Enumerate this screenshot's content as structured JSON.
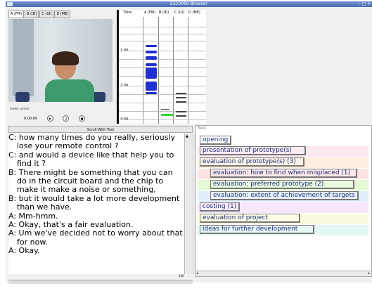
{
  "window": {
    "title": "ES20060 Browser"
  },
  "tabs": [
    "A (FM)",
    "B (ID)",
    "C (UI)",
    "D (ME)"
  ],
  "media": {
    "label": "media control",
    "time": "0:00:00"
  },
  "timeline": {
    "headers": [
      "Time",
      "A (FM)",
      "B (ID)",
      "C (UI)",
      "D (ME)"
    ],
    "ticks": [
      "1:00",
      "2:00",
      "3:00"
    ]
  },
  "scroll_button": "Scroll With Text",
  "transcript": [
    "C: how many times do you really, seriously lose your  remote control ?",
    "C: and would a device like that help you to find it ?",
    "B: There might be something that you can do in the circuit board and the chip to make it make a noise or something,",
    "B: but it would take a lot more development than we have.",
    "A: Mm-hmm.",
    "A: Okay, that's a fair evaluation.",
    "A: Um we've decided not to worry about that for now.",
    "A: Okay."
  ],
  "transcript_zoom": "100",
  "topics_label": "Topics",
  "topics": [
    {
      "label": "opening",
      "bg": "#ffffff"
    },
    {
      "label": "presentation of prototype(s)",
      "bg": "#fde7ef"
    },
    {
      "label": "evaluation of prototype(s) (3)",
      "bg": "#fdeee0"
    },
    {
      "label": "evaluation: how to find when misplaced (1)",
      "bg": "#fde3e3"
    },
    {
      "label": "evaluation: preferred prototype (2)",
      "bg": "#e6f8d6"
    },
    {
      "label": "evaluation: extent of achievement of targets",
      "bg": "#e3eefc"
    },
    {
      "label": "costing (1)",
      "bg": "#f6e8f9"
    },
    {
      "label": "evaluation of project",
      "bg": "#fcfbe0"
    },
    {
      "label": "ideas for further development",
      "bg": "#e4f7f5"
    }
  ]
}
